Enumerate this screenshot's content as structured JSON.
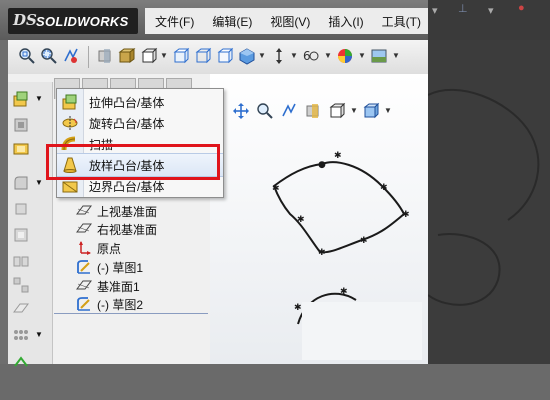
{
  "app": {
    "brand_prefix": "DS",
    "brand_name": "SOLIDWORKS"
  },
  "menubar": {
    "items": [
      {
        "label": "文件(F)"
      },
      {
        "label": "编辑(E)"
      },
      {
        "label": "视图(V)"
      },
      {
        "label": "插入(I)"
      },
      {
        "label": "工具(T)"
      }
    ]
  },
  "toolbar": {
    "icons": [
      "zoom-to-fit-icon",
      "zoom-area-icon",
      "previous-view-icon",
      "section-view-icon",
      "view-orientation-icon",
      "display-style-icon",
      "hide-show-icon",
      "edit-appearance-icon",
      "apply-scene-icon",
      "view-settings-icon",
      "render-icon"
    ]
  },
  "feature_dropdown": {
    "items": [
      {
        "label": "拉伸凸台/基体",
        "icon": "extrude-boss-icon"
      },
      {
        "label": "旋转凸台/基体",
        "icon": "revolve-boss-icon"
      },
      {
        "label": "扫描",
        "icon": "sweep-icon"
      },
      {
        "label": "放样凸台/基体",
        "icon": "loft-boss-icon",
        "highlighted": true
      },
      {
        "label": "边界凸台/基体",
        "icon": "boundary-boss-icon"
      }
    ]
  },
  "feature_tree": {
    "items": [
      {
        "label": "上视基准面",
        "icon": "plane-icon"
      },
      {
        "label": "右视基准面",
        "icon": "plane-icon"
      },
      {
        "label": "原点",
        "icon": "origin-icon"
      },
      {
        "label": "(-) 草图1",
        "icon": "sketch-icon"
      },
      {
        "label": "基准面1",
        "icon": "plane-icon"
      },
      {
        "label": "(-) 草图2",
        "icon": "sketch-icon"
      }
    ]
  },
  "colors": {
    "highlight_border": "#e0141b",
    "sketch": "#222222",
    "accent_blue": "#2f6fcf"
  }
}
